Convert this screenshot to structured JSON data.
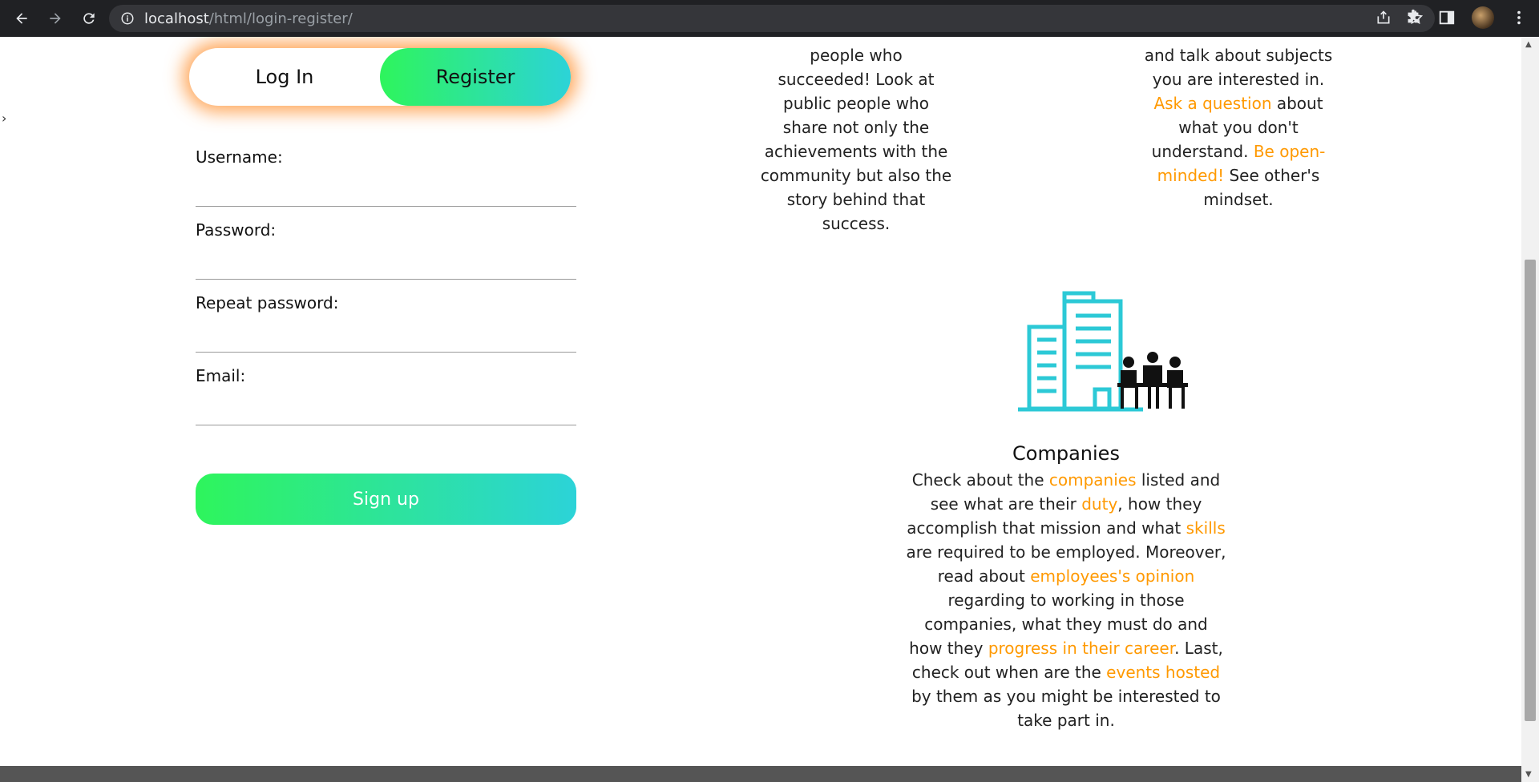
{
  "browser": {
    "url_host": "localhost",
    "url_path": "/html/login-register/"
  },
  "toggle": {
    "login_label": "Log In",
    "register_label": "Register"
  },
  "form": {
    "username_label": "Username:",
    "password_label": "Password:",
    "repeat_password_label": "Repeat password:",
    "email_label": "Email:",
    "signup_label": "Sign up"
  },
  "columns": {
    "col1": [
      "people who",
      "succeeded! Look at",
      "public people who",
      "share not only the",
      "achievements with the",
      "community but also the",
      "story behind that",
      "success."
    ],
    "col2_l1": "and talk about subjects",
    "col2_l2": "you are interested in.",
    "col2_ask": "Ask a question",
    "col2_about": " about",
    "col2_l4": "what you don't",
    "col2_l5a": "understand. ",
    "col2_be": "Be open-",
    "col2_minded": "minded!",
    "col2_l6b": " See other's",
    "col2_l7": "mindset."
  },
  "companies": {
    "title": "Companies",
    "t1": "Check about the ",
    "h1": "companies",
    "t2": " listed and see what are their ",
    "h2": "duty",
    "t3": ", how they accomplish that mission and what ",
    "h3": "skills",
    "t4": " are required to be employed. Moreover, read about ",
    "h4": "employees's opinion",
    "t5": " regarding to working in those companies, what they must do and how they ",
    "h5": "progress in their career",
    "t6": ". Last, check out when are the ",
    "h6": "events hosted",
    "t7": " by them as you might be interested to take part in."
  },
  "colors": {
    "accent_orange": "#ff9900",
    "gradient_start": "#2ef55c",
    "gradient_end": "#2cd3d8",
    "illustration_teal": "#2cc9d6"
  }
}
